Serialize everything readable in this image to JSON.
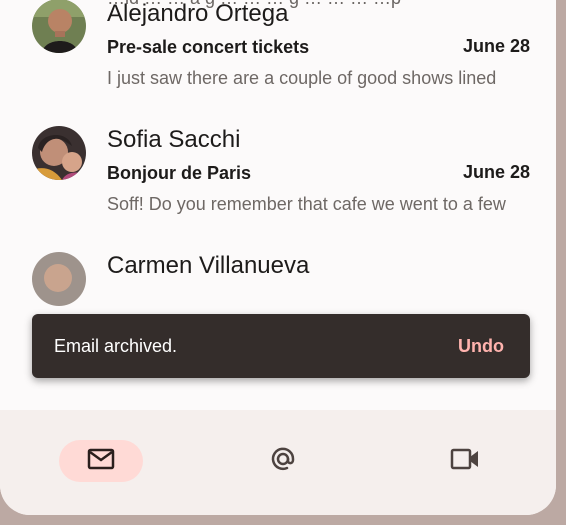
{
  "list": {
    "partial_preview": "…ld … … a g … … … g … … … …p",
    "items": [
      {
        "sender": "Alejandro Ortega",
        "subject": "Pre-sale concert tickets",
        "date": "June 28",
        "preview": "I just saw there are a couple of good shows lined",
        "avatar": "avatar-alejandro"
      },
      {
        "sender": "Sofia Sacchi",
        "subject": "Bonjour de Paris",
        "date": "June 28",
        "preview": "Soff! Do you remember that cafe we went to a few",
        "avatar": "avatar-sofia"
      },
      {
        "sender": "Carmen Villanueva",
        "subject": "",
        "date": "",
        "preview": "",
        "avatar": "avatar-carmen"
      }
    ]
  },
  "snackbar": {
    "message": "Email archived.",
    "action": "Undo",
    "action_color": "#ffb3ae"
  },
  "navbar": {
    "items": [
      {
        "icon": "mail-icon",
        "active": true
      },
      {
        "icon": "at-sign-icon",
        "active": false
      },
      {
        "icon": "video-icon",
        "active": false
      }
    ],
    "active_color": "#ffdad6"
  }
}
